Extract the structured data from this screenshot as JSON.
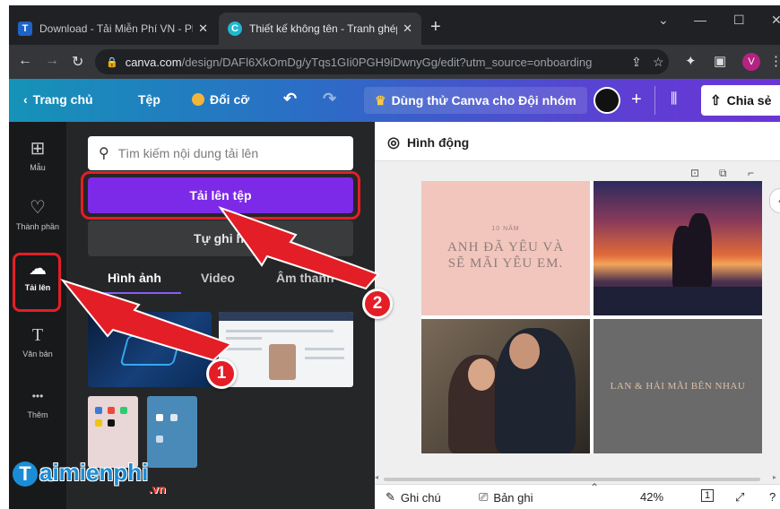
{
  "browser": {
    "tabs": [
      {
        "favicon": "T",
        "title": "Download - Tải Miễn Phí VN - Ph",
        "close": "✕"
      },
      {
        "favicon": "C",
        "title": "Thiết kế không tên - Tranh ghép",
        "close": "✕"
      }
    ],
    "new_tab": "+",
    "url_host": "canva.com",
    "url_path": "/design/DAFl6XkOmDg/yTqs1GIi0PGH9iDwnyGg/edit?utm_source=onboarding",
    "profile_initial": "V"
  },
  "canva_header": {
    "home": "Trang chủ",
    "file": "Tệp",
    "resize": "Đổi cỡ",
    "try_team": "Dùng thử Canva cho Đội nhóm",
    "share": "Chia sẻ"
  },
  "rail": {
    "items": [
      {
        "label": "Mẫu",
        "icon": "⊞"
      },
      {
        "label": "Thành phần",
        "icon": "♡"
      },
      {
        "label": "Tải lên",
        "icon": "☁"
      },
      {
        "label": "Văn bản",
        "icon": "T"
      },
      {
        "label": "Thêm",
        "icon": "•••"
      }
    ]
  },
  "upload_panel": {
    "search_placeholder": "Tìm kiếm nội dung tải lên",
    "upload_button": "Tải lên tệp",
    "record_button": "Tự ghi hì",
    "tabs": [
      "Hình ảnh",
      "Video",
      "Âm thanh"
    ]
  },
  "workspace": {
    "animate": "Hình động",
    "collage": {
      "small_text": "10 NĂM",
      "quote_line1": "ANH ĐÃ YÊU VÀ",
      "quote_line2": "SẼ MÃI YÊU EM.",
      "caption": "LAN & HẢI MÃI BÊN NHAU"
    },
    "footer": {
      "notes": "Ghi chú",
      "recording": "Bản ghi",
      "zoom": "42%",
      "page": "1"
    }
  },
  "annotations": {
    "step1": "1",
    "step2": "2",
    "color": "#e41e26"
  },
  "watermark": {
    "brand_initial": "T",
    "brand_rest": "aimienphi",
    "tld": ".vn"
  },
  "colors": {
    "canva_purple": "#7d2ae8",
    "annotation_red": "#e41e26"
  }
}
